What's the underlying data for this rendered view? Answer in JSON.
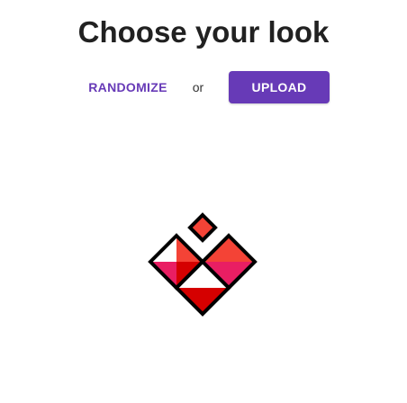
{
  "header": {
    "title": "Choose your look"
  },
  "actions": {
    "randomize_label": "RANDOMIZE",
    "separator": "or",
    "upload_label": "UPLOAD"
  },
  "colors": {
    "accent": "#673ab7",
    "avatar_red": "#f44336",
    "avatar_pink": "#e91e63",
    "avatar_dark_red": "#d50000"
  },
  "avatar": {
    "icon": "identicon-avatar"
  }
}
